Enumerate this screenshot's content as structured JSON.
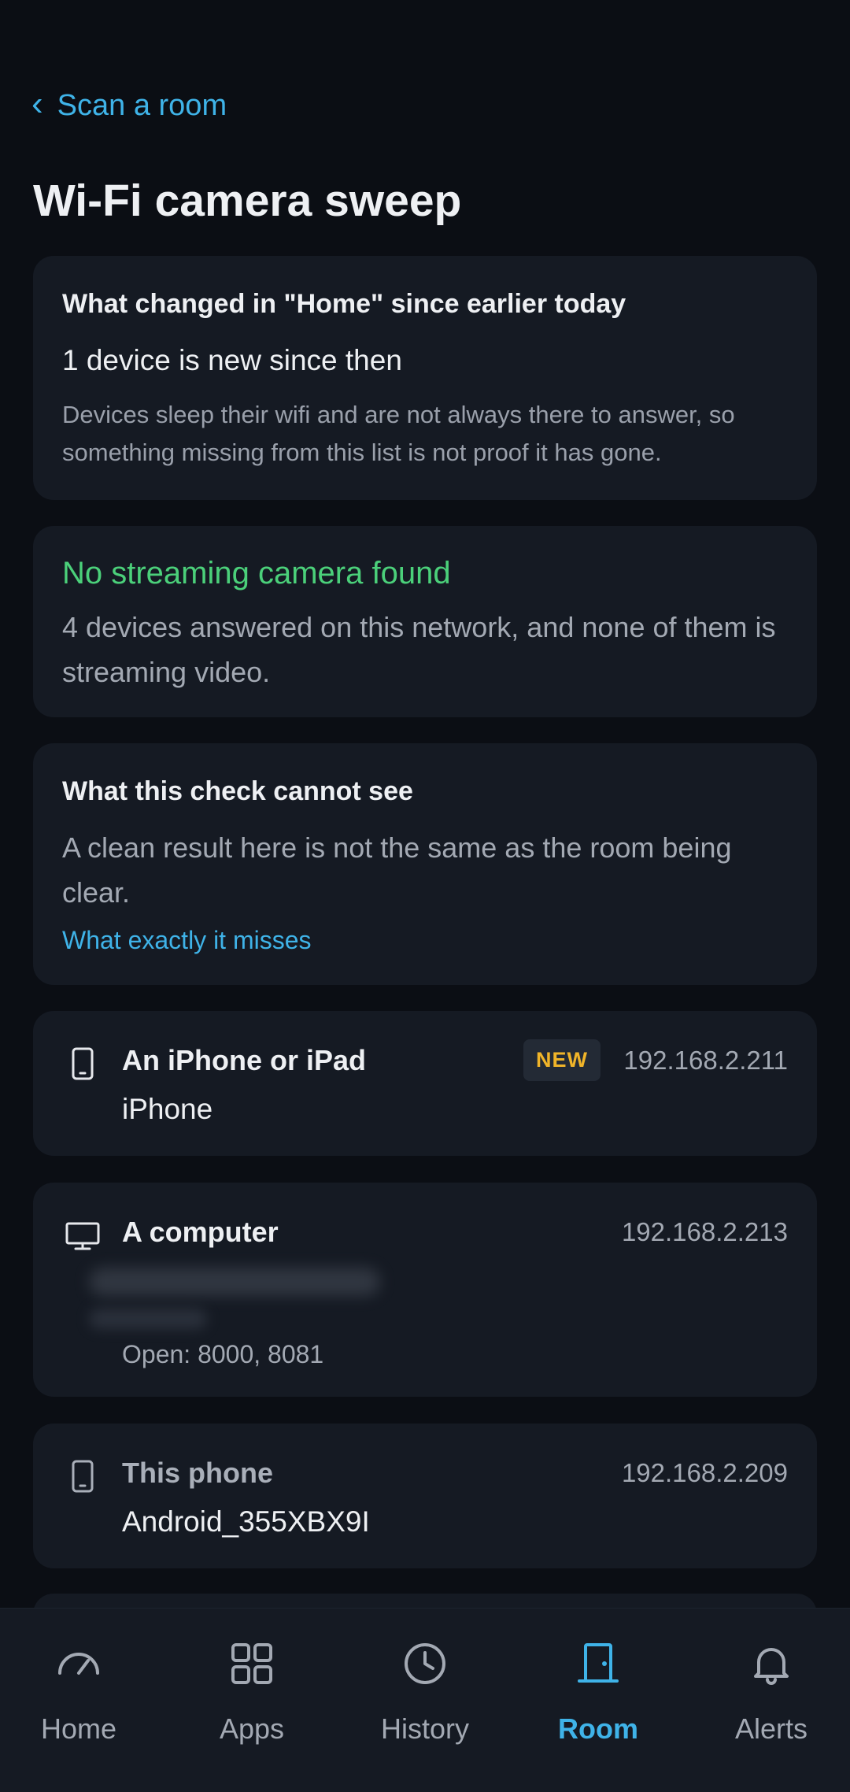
{
  "header": {
    "back_label": "Scan a room",
    "title": "Wi-Fi camera sweep"
  },
  "changes": {
    "heading": "What changed in \"Home\" since earlier today",
    "summary": "1 device is new since then",
    "note": "Devices sleep their wifi and are not always there to answer, so something missing from this list is not proof it has gone."
  },
  "result": {
    "heading": "No streaming camera found",
    "detail": "4 devices answered on this network, and none of them is streaming video.",
    "color": "#4bd07a"
  },
  "limits": {
    "heading": "What this check cannot see",
    "detail": "A clean result here is not the same as the room being clear.",
    "link": "What exactly it misses"
  },
  "devices": [
    {
      "icon": "phone-icon",
      "name": "An iPhone or iPad",
      "subtitle": "iPhone",
      "badge": "NEW",
      "ip": "192.168.2.211"
    },
    {
      "icon": "computer-icon",
      "name": "A computer",
      "subtitle": "",
      "ports": "Open: 8000, 8081",
      "ip": "192.168.2.213"
    },
    {
      "icon": "phone-icon",
      "name": "This phone",
      "subtitle": "Android_355XBX9I",
      "ip": "192.168.2.209"
    }
  ],
  "nav": {
    "items": [
      {
        "label": "Home",
        "icon": "gauge-icon"
      },
      {
        "label": "Apps",
        "icon": "grid-icon"
      },
      {
        "label": "History",
        "icon": "clock-icon"
      },
      {
        "label": "Room",
        "icon": "door-icon",
        "active": true
      },
      {
        "label": "Alerts",
        "icon": "bell-icon"
      }
    ]
  },
  "colors": {
    "accent": "#3fb3e8",
    "badge": "#f0b429",
    "background": "#0b0e14",
    "card": "#151a23"
  }
}
